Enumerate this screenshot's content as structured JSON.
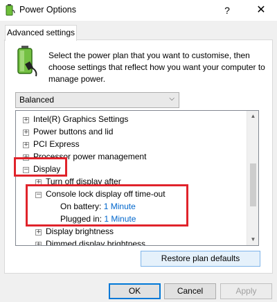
{
  "window": {
    "title": "Power Options",
    "help_label": "?",
    "close_label": "✕"
  },
  "tab": {
    "label": "Advanced settings"
  },
  "description": "Select the power plan that you want to customise, then choose settings that reflect how you want your computer to manage power.",
  "plan_select": {
    "value": "Balanced"
  },
  "tree": {
    "items": [
      {
        "label": "Intel(R) Graphics Settings",
        "expander": "+"
      },
      {
        "label": "Power buttons and lid",
        "expander": "+"
      },
      {
        "label": "PCI Express",
        "expander": "+"
      },
      {
        "label": "Processor power management",
        "expander": "+"
      },
      {
        "label": "Display",
        "expander": "−"
      },
      {
        "label": "Turn off display after",
        "expander": "+"
      },
      {
        "label": "Console lock display off time-out",
        "expander": "−"
      },
      {
        "label": "Display brightness",
        "expander": "+"
      },
      {
        "label": "Dimmed display brightness",
        "expander": "+"
      }
    ],
    "on_battery": {
      "label": "On battery:",
      "value": "1 Minute"
    },
    "plugged_in": {
      "label": "Plugged in:",
      "value": "1 Minute"
    }
  },
  "buttons": {
    "restore": "Restore plan defaults",
    "ok": "OK",
    "cancel": "Cancel",
    "apply": "Apply"
  },
  "colors": {
    "highlight": "#e0232b",
    "link": "#0066cc",
    "accent": "#0078d7"
  },
  "icons": {
    "title": "power-options-icon",
    "plan": "battery-plug-icon"
  }
}
